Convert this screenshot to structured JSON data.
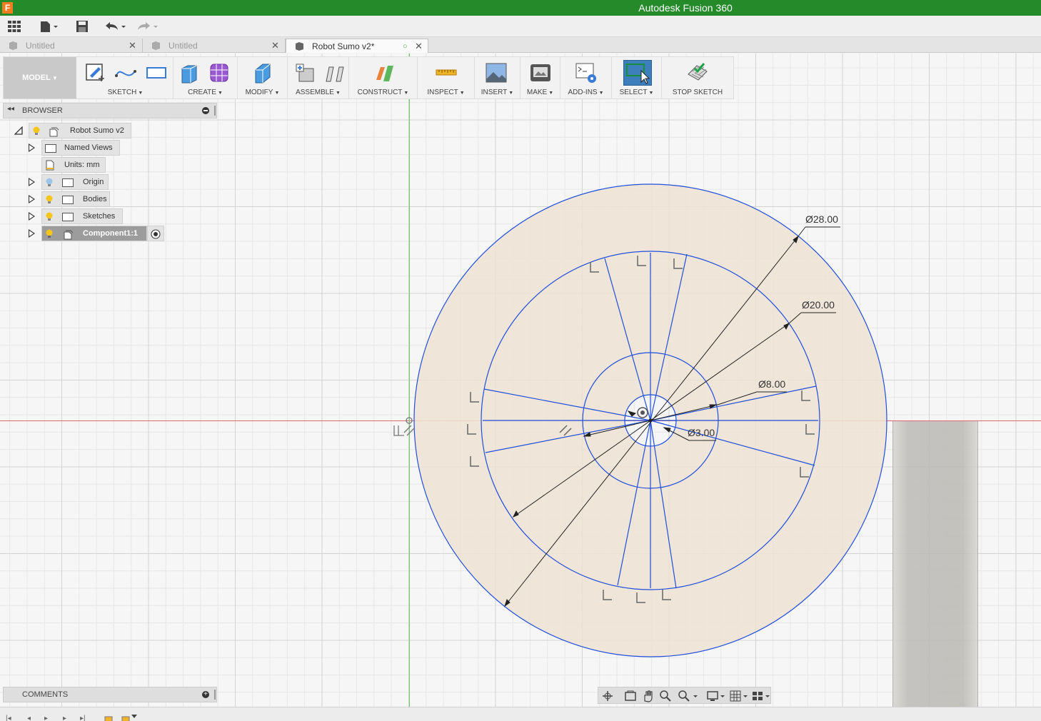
{
  "window": {
    "title": "Autodesk Fusion 360",
    "app_icon": "F"
  },
  "tabs": [
    {
      "label": "Untitled",
      "active": false
    },
    {
      "label": "Untitled",
      "active": false
    },
    {
      "label": "Robot Sumo v2*",
      "active": true
    }
  ],
  "toolbar": {
    "workspace": "MODEL",
    "groups": {
      "sketch": "SKETCH",
      "create": "CREATE",
      "modify": "MODIFY",
      "assemble": "ASSEMBLE",
      "construct": "CONSTRUCT",
      "inspect": "INSPECT",
      "insert": "INSERT",
      "make": "MAKE",
      "addins": "ADD-INS",
      "select": "SELECT",
      "stop_sketch": "STOP SKETCH"
    }
  },
  "browser": {
    "title": "BROWSER",
    "root": "Robot Sumo v2",
    "items": [
      {
        "label": "Named Views"
      },
      {
        "label": "Units: mm"
      },
      {
        "label": "Origin"
      },
      {
        "label": "Bodies"
      },
      {
        "label": "Sketches"
      },
      {
        "label": "Component1:1"
      }
    ]
  },
  "comments": {
    "title": "COMMENTS"
  },
  "sketch": {
    "dimensions": {
      "d28": "Ø28.00",
      "d20": "Ø20.00",
      "d8": "Ø8.00",
      "d3": "Ø3.00"
    },
    "colors": {
      "sketch_line": "#1f4fdb",
      "profile_fill": "#efe2d4",
      "x_axis": "#e06a6a",
      "y_axis": "#63d163",
      "title_bar": "#248a2a",
      "select_active": "#3d7fbd"
    }
  }
}
